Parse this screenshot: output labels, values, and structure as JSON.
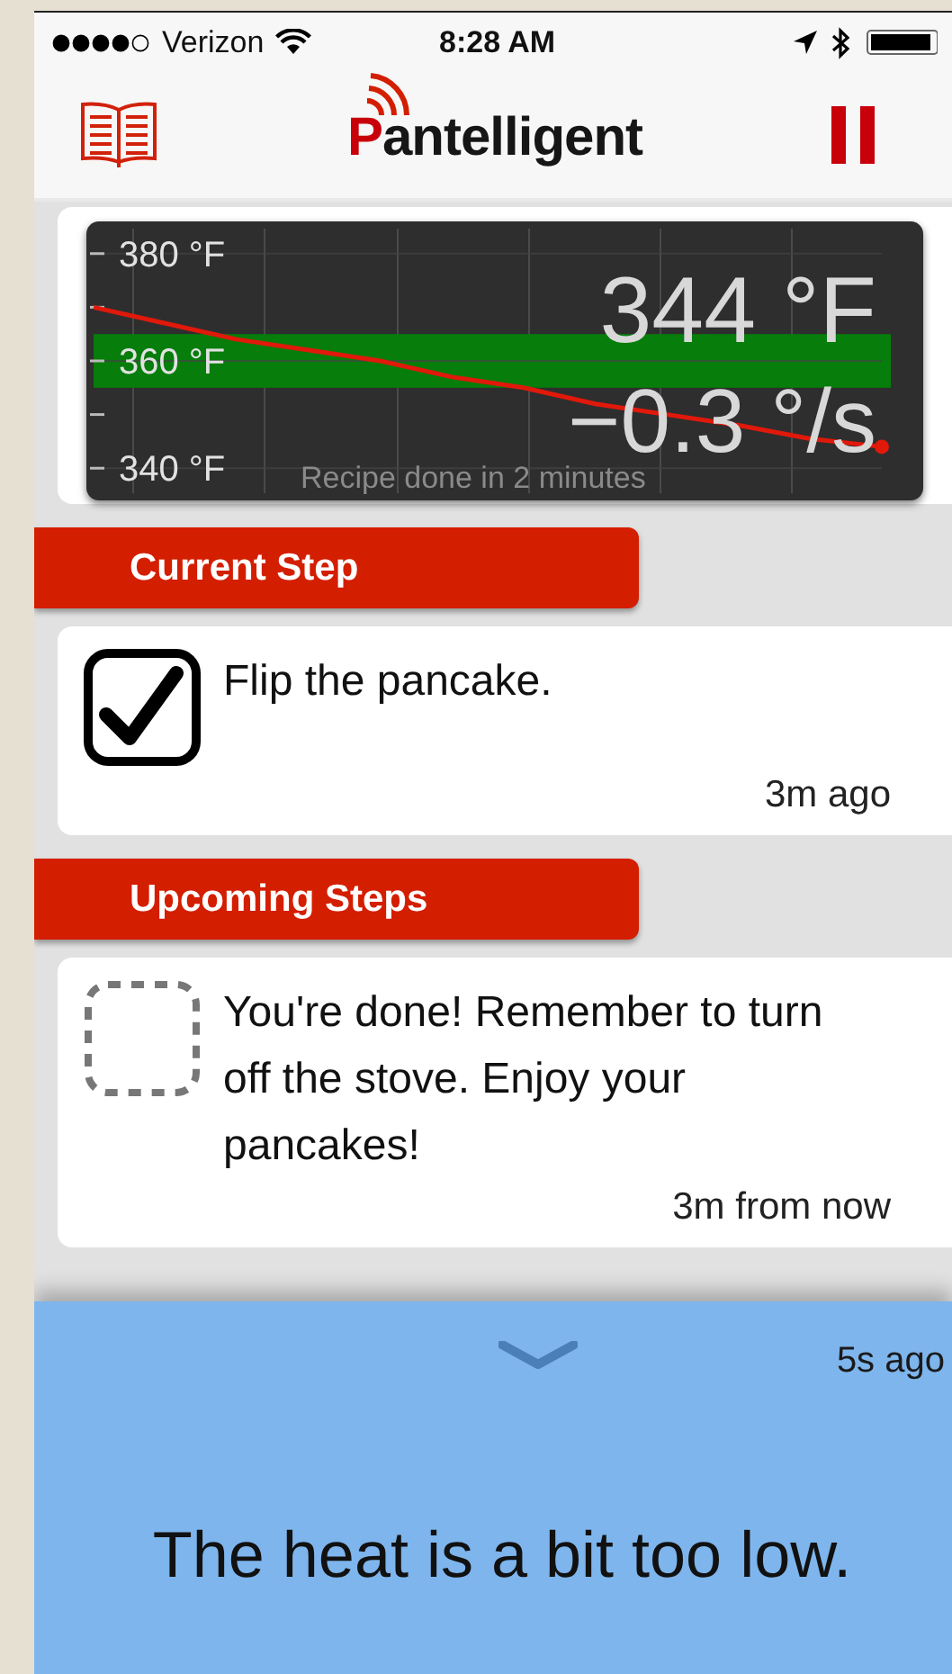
{
  "status_bar": {
    "carrier": "Verizon",
    "time": "8:28 AM"
  },
  "nav": {
    "logo": "Pantelligent"
  },
  "monitor": {
    "current_temp": "344 °F",
    "rate": "−0.3 °/s",
    "eta": "Recipe done in 2 minutes",
    "chart_data": {
      "type": "line",
      "grid": true,
      "ylim": [
        334,
        386
      ],
      "yticks": [
        {
          "value": 340,
          "label": "340 °F"
        },
        {
          "value": 360,
          "label": "360 °F"
        },
        {
          "value": 380,
          "label": "380 °F"
        }
      ],
      "series": [
        {
          "color": "#e0190b",
          "values": [
            370,
            367,
            364,
            362,
            360,
            357,
            355,
            352,
            350,
            348,
            345.5,
            344
          ]
        }
      ],
      "bands": [
        {
          "axis": "y",
          "from": 355,
          "to": 365,
          "color": "#077d0b"
        }
      ]
    }
  },
  "sections": [
    {
      "title": "Current Step",
      "steps": [
        {
          "text": "Flip the pancake.",
          "time": "3m ago",
          "checked": true
        }
      ]
    },
    {
      "title": "Upcoming Steps",
      "steps": [
        {
          "text": "You're done! Remember to turn off the stove. Enjoy your pancakes!",
          "time": "3m from now",
          "checked": false
        }
      ]
    }
  ],
  "alert": {
    "time": "5s ago",
    "message": "The heat is a bit too low."
  }
}
